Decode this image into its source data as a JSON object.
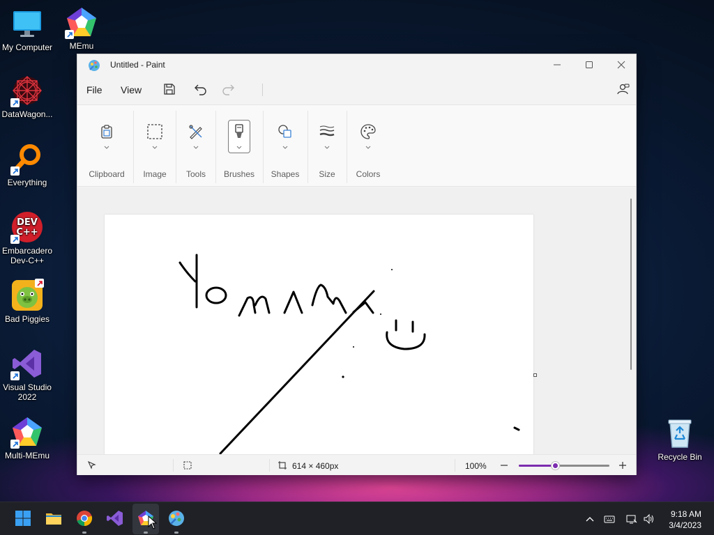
{
  "desktop": {
    "icons": [
      {
        "label": "My Computer",
        "icon": "monitor-icon"
      },
      {
        "label": "MEmu",
        "icon": "memu-icon"
      },
      {
        "label": "DataWagon...",
        "icon": "datawagon-icon"
      },
      {
        "label": "Everything",
        "icon": "everything-search-icon"
      },
      {
        "label": "Embarcadero\nDev-C++",
        "icon": "devcpp-icon"
      },
      {
        "label": "Bad Piggies",
        "icon": "bad-piggies-icon"
      },
      {
        "label": "Visual Studio\n2022",
        "icon": "visual-studio-icon"
      },
      {
        "label": "Multi-MEmu",
        "icon": "multi-memu-icon"
      },
      {
        "label": "Recycle Bin",
        "icon": "recycle-bin-icon"
      }
    ]
  },
  "window": {
    "title": "Untitled - Paint",
    "menu": {
      "file": "File",
      "view": "View"
    },
    "ribbon": {
      "groups": [
        "Clipboard",
        "Image",
        "Tools",
        "Brushes",
        "Shapes",
        "Size",
        "Colors"
      ]
    },
    "status": {
      "dimensions": "614 × 460px",
      "zoom": "100%",
      "zoom_level": 0.4
    }
  },
  "taskbar": {
    "apps": [
      "start-icon",
      "file-explorer-icon",
      "chrome-icon",
      "visual-studio-icon",
      "memu-icon",
      "paint-icon"
    ],
    "active_app": "memu-icon",
    "clock": {
      "time": "9:18 AM",
      "date": "3/4/2023"
    }
  },
  "colors": {
    "accent": "#7b2cae",
    "taskbar": "#1f2126",
    "window_bg": "#f3f3f3"
  }
}
